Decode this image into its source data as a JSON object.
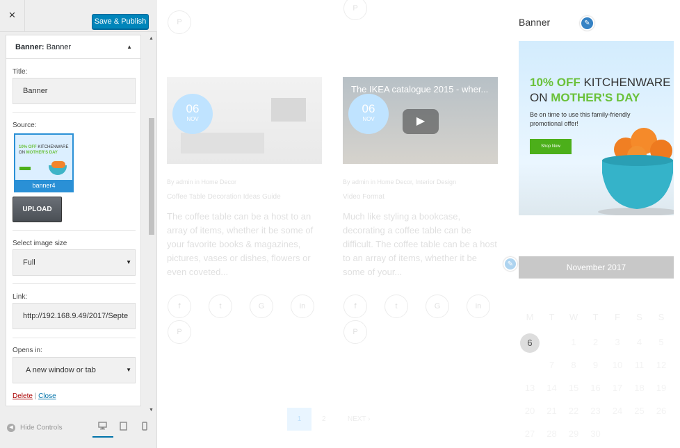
{
  "customizer": {
    "close_icon": "×",
    "publish_label": "Save & Publish",
    "section": {
      "title_bold": "Banner:",
      "title_rest": " Banner"
    },
    "title_label": "Title:",
    "title_value": "Banner",
    "source_label": "Source:",
    "thumb_caption": "banner4",
    "thumb_text": {
      "l1_green": "10% OFF",
      "l1_rest": " KITCHENWARE",
      "l2_rest": "ON ",
      "l2_green": "MOTHER'S DAY"
    },
    "upload_label": "UPLOAD",
    "size_label": "Select image size",
    "size_value": "Full",
    "link_label": "Link:",
    "link_value": "http://192.168.9.49/2017/Septe",
    "opens_label": "Opens in:",
    "opens_value": "A new window or tab",
    "delete_label": "Delete",
    "separator": "|",
    "close_label": "Close",
    "hide_controls": "Hide Controls"
  },
  "posts": [
    {
      "day": "06",
      "month": "NOV",
      "meta": "By admin in Home Decor",
      "title": "Coffee Table Decoration Ideas Guide",
      "excerpt": "The coffee table can be a host to an array of items, whether it be some of your favorite books & magazines, pictures, vases or dishes, flowers or even coveted...",
      "video_title": ""
    },
    {
      "day": "06",
      "month": "NOV",
      "meta": "By admin in Home Decor, Interior Design",
      "title": "Video Format",
      "excerpt": "Much like styling a bookcase, decorating a coffee table can be difficult. The coffee table can be a host to an array of items, whether it be some of your...",
      "video_title": "The IKEA catalogue 2015 - wher..."
    }
  ],
  "pagination": {
    "current": "1",
    "page2": "2",
    "next": "NEXT ›"
  },
  "sidebar": {
    "widget_title": "Banner",
    "banner": {
      "l1_green": "10% OFF",
      "l1_rest": " KITCHENWARE",
      "l2_rest": "ON ",
      "l2_green": "MOTHER'S DAY",
      "text": "Be on time to use this family-friendly promotional offer!",
      "button": "Shop Now"
    },
    "calendar": {
      "month": "November 2017",
      "dow": [
        "M",
        "T",
        "W",
        "T",
        "F",
        "S",
        "S"
      ],
      "rows": [
        [
          "",
          "",
          "1",
          "2",
          "3",
          "4",
          "5"
        ],
        [
          "6",
          "7",
          "8",
          "9",
          "10",
          "11",
          "12"
        ],
        [
          "13",
          "14",
          "15",
          "16",
          "17",
          "18",
          "19"
        ],
        [
          "20",
          "21",
          "22",
          "23",
          "24",
          "25",
          "26"
        ],
        [
          "27",
          "28",
          "29",
          "30",
          "",
          "",
          ""
        ]
      ],
      "today": "6"
    }
  },
  "colors": {
    "accent": "#0085ba",
    "green": "#6ac13a",
    "pen": "#3582c4"
  }
}
